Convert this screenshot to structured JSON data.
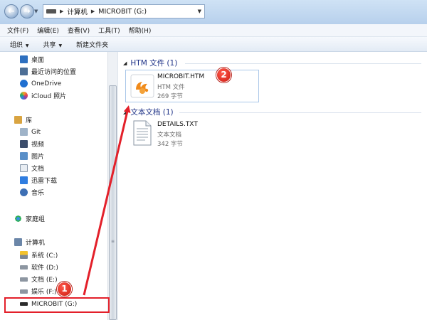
{
  "address": {
    "crumbs": [
      "计算机",
      "MICROBIT (G:)"
    ]
  },
  "menu": [
    "文件(F)",
    "编辑(E)",
    "查看(V)",
    "工具(T)",
    "帮助(H)"
  ],
  "toolbar": {
    "organize": "组织",
    "share": "共享",
    "new_folder": "新建文件夹"
  },
  "nav": {
    "favorites": [
      "桌面",
      "最近访问的位置",
      "OneDrive",
      "iCloud 照片"
    ],
    "library": "库",
    "library_items": [
      "Git",
      "视频",
      "图片",
      "文档",
      "迅雷下载",
      "音乐"
    ],
    "homegroup": "家庭组",
    "computer": "计算机",
    "drives": [
      "系统 (C:)",
      "软件 (D:)",
      "文档 (E:)",
      "娱乐 (F:)",
      "MICROBIT (G:)"
    ]
  },
  "content": {
    "groups": [
      {
        "header": "HTM 文件 (1)",
        "file": {
          "name": "MICROBIT.HTM",
          "type": "HTM 文件",
          "size": "269 字节"
        }
      },
      {
        "header": "文本文档 (1)",
        "file": {
          "name": "DETAILS.TXT",
          "type": "文本文档",
          "size": "342 字节"
        }
      }
    ]
  },
  "annotations": {
    "badge1": "1",
    "badge2": "2",
    "arrow_color": "#e3202a"
  }
}
